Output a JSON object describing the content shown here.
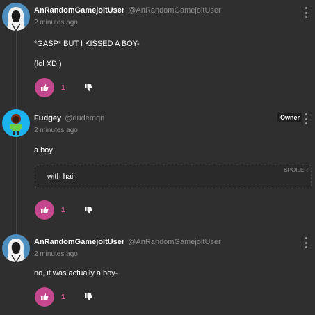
{
  "comments": [
    {
      "author": "AnRandomGamejoltUser",
      "handle": "@AnRandomGamejoltUser",
      "time": "2 minutes ago",
      "lines": [
        "*GASP* BUT I KISSED A BOY-",
        "(lol XD )"
      ],
      "likes": "1"
    },
    {
      "author": "Fudgey",
      "handle": "@dudemqn",
      "badge": "Owner",
      "time": "2 minutes ago",
      "lines": [
        "a boy"
      ],
      "spoiler": {
        "label": "SPOILER",
        "text": "with hair"
      },
      "likes": "1"
    },
    {
      "author": "AnRandomGamejoltUser",
      "handle": "@AnRandomGamejoltUser",
      "time": "2 minutes ago",
      "lines": [
        "no, it was actually a boy-"
      ],
      "likes": "1"
    }
  ],
  "icons": {
    "like": "thumbs-up-icon",
    "dislike": "thumbs-down-icon",
    "menu": "kebab-menu-icon"
  },
  "colors": {
    "background": "#2f2f2f",
    "like_button": "#c5478e",
    "like_count": "#d9649d",
    "muted_text": "#8c8c8c"
  }
}
